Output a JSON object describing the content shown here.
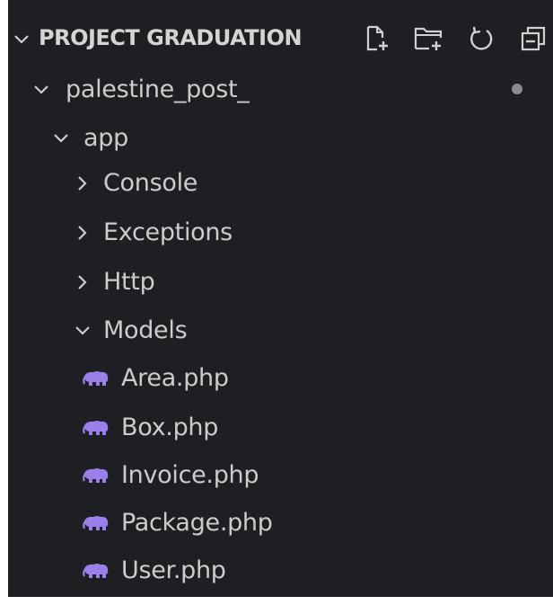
{
  "explorer": {
    "section_title": "PROJECT GRADUATION",
    "actions": [
      {
        "name": "new-file-icon"
      },
      {
        "name": "new-folder-icon"
      },
      {
        "name": "refresh-icon"
      },
      {
        "name": "collapse-all-icon"
      }
    ],
    "tree": [
      {
        "label": "palestine_post_",
        "type": "folder",
        "expanded": true,
        "depth": 0
      },
      {
        "label": "app",
        "type": "folder",
        "expanded": true,
        "depth": 1
      },
      {
        "label": "Console",
        "type": "folder",
        "expanded": false,
        "depth": 2
      },
      {
        "label": "Exceptions",
        "type": "folder",
        "expanded": false,
        "depth": 2
      },
      {
        "label": "Http",
        "type": "folder",
        "expanded": false,
        "depth": 2
      },
      {
        "label": "Models",
        "type": "folder",
        "expanded": true,
        "depth": 2
      },
      {
        "label": "Area.php",
        "type": "file",
        "icon": "php-icon",
        "depth": 3
      },
      {
        "label": "Box.php",
        "type": "file",
        "icon": "php-icon",
        "depth": 3
      },
      {
        "label": "Invoice.php",
        "type": "file",
        "icon": "php-icon",
        "depth": 3
      },
      {
        "label": "Package.php",
        "type": "file",
        "icon": "php-icon",
        "depth": 3
      },
      {
        "label": "User.php",
        "type": "file",
        "icon": "php-icon",
        "depth": 3
      }
    ]
  },
  "colors": {
    "background": "#1e1f22",
    "text": "#cccccc",
    "php_icon": "#9b7fe8",
    "modified_dot": "#8b8b8b"
  }
}
